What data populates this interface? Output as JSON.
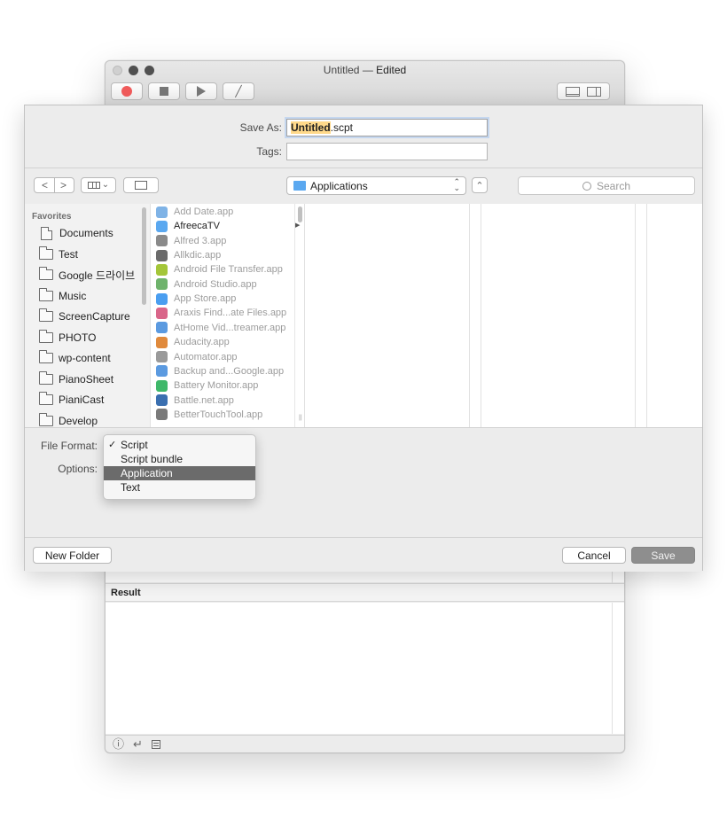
{
  "window": {
    "title_main": "Untitled",
    "title_sep": " — ",
    "title_state": "Edited"
  },
  "result": {
    "label": "Result"
  },
  "save": {
    "save_as_label": "Save As:",
    "file_name_highlight": "Untitled",
    "file_name_ext": ".scpt",
    "tags_label": "Tags:",
    "tags_value": ""
  },
  "nav": {
    "location": "Applications",
    "search_placeholder": "Search",
    "back_glyph": "<",
    "forward_glyph": ">",
    "view_chevron": "⌄",
    "expand_glyph": "⌃",
    "popup_up": "⌃",
    "popup_down": "⌄"
  },
  "sidebar": {
    "heading": "Favorites",
    "items": [
      {
        "label": "Documents",
        "icon": "document-icon"
      },
      {
        "label": "Test",
        "icon": "folder-icon"
      },
      {
        "label": "Google 드라이브",
        "icon": "folder-icon"
      },
      {
        "label": "Music",
        "icon": "folder-icon"
      },
      {
        "label": "ScreenCapture",
        "icon": "folder-icon"
      },
      {
        "label": "PHOTO",
        "icon": "folder-icon"
      },
      {
        "label": "wp-content",
        "icon": "folder-icon"
      },
      {
        "label": "PianoSheet",
        "icon": "folder-icon"
      },
      {
        "label": "PianiCast",
        "icon": "folder-icon"
      },
      {
        "label": "Develop",
        "icon": "folder-icon"
      }
    ]
  },
  "files": [
    {
      "name": "Add Date.app",
      "color": "#7fb3e6",
      "active": false
    },
    {
      "name": "AfreecaTV",
      "color": "#5aa8f0",
      "active": true
    },
    {
      "name": "Alfred 3.app",
      "color": "#8a8a8a",
      "active": false
    },
    {
      "name": "Allkdic.app",
      "color": "#6b6b6b",
      "active": false
    },
    {
      "name": "Android File Transfer.app",
      "color": "#a4c639",
      "active": false
    },
    {
      "name": "Android Studio.app",
      "color": "#6fb36c",
      "active": false
    },
    {
      "name": "App Store.app",
      "color": "#4a9ef0",
      "active": false
    },
    {
      "name": "Araxis Find...ate Files.app",
      "color": "#d9668a",
      "active": false
    },
    {
      "name": "AtHome Vid...treamer.app",
      "color": "#5b9ae0",
      "active": false
    },
    {
      "name": "Audacity.app",
      "color": "#e08a3c",
      "active": false
    },
    {
      "name": "Automator.app",
      "color": "#9a9a9a",
      "active": false
    },
    {
      "name": "Backup and...Google.app",
      "color": "#5b9ae0",
      "active": false
    },
    {
      "name": "Battery Monitor.app",
      "color": "#3fb86a",
      "active": false
    },
    {
      "name": "Battle.net.app",
      "color": "#3a6fb0",
      "active": false
    },
    {
      "name": "BetterTouchTool.app",
      "color": "#7a7a7a",
      "active": false
    }
  ],
  "folder_arrow": "▶",
  "options": {
    "file_format_label": "File Format:",
    "options_label": "Options:",
    "check_glyph": "✓",
    "menu": [
      {
        "label": "Script",
        "checked": true,
        "selected": false
      },
      {
        "label": "Script bundle",
        "checked": false,
        "selected": false
      },
      {
        "label": "Application",
        "checked": false,
        "selected": true
      },
      {
        "label": "Text",
        "checked": false,
        "selected": false
      }
    ]
  },
  "footer": {
    "new_folder": "New Folder",
    "cancel": "Cancel",
    "save": "Save"
  },
  "bottombar": {
    "info_glyph": "ⓘ",
    "return_glyph": "↵"
  },
  "colors": {
    "record": "#f05b5b",
    "menu_selection": "#6b6b6b",
    "folder_blue": "#5aa8f0"
  }
}
